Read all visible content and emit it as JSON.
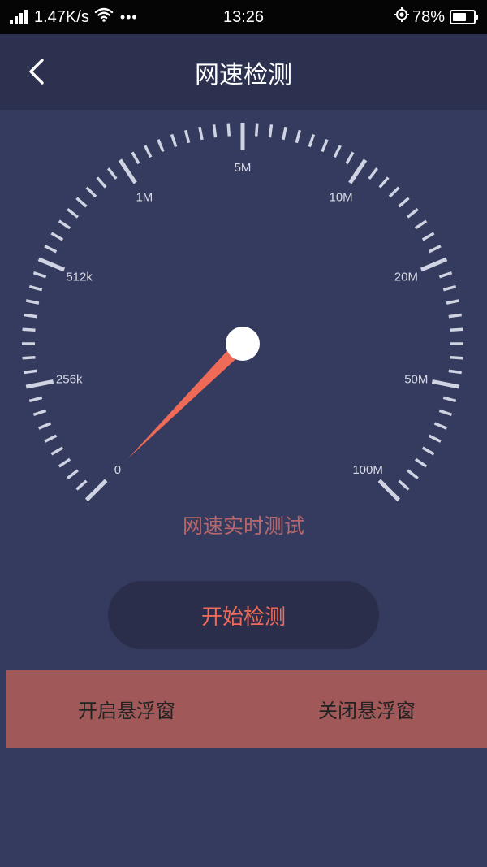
{
  "status_bar": {
    "net_speed": "1.47K/s",
    "more": "•••",
    "time": "13:26",
    "battery": "78%",
    "battery_level": 0.78
  },
  "nav": {
    "title": "网速检测"
  },
  "gauge": {
    "labels": [
      "0",
      "256k",
      "512k",
      "1M",
      "5M",
      "10M",
      "20M",
      "50M",
      "100M"
    ],
    "needle_position": 0,
    "caption": "网速实时测试",
    "colors": {
      "ticks": "#d0d3e2",
      "labels": "#d8dbe6",
      "needle": "#f06a58",
      "hub": "#ffffff"
    }
  },
  "actions": {
    "start_label": "开始检测",
    "open_float_label": "开启悬浮窗",
    "close_float_label": "关闭悬浮窗"
  },
  "colors": {
    "background": "#353b5e",
    "nav_background": "#2d3150",
    "accent": "#f06a58",
    "panel": "#a05858"
  }
}
